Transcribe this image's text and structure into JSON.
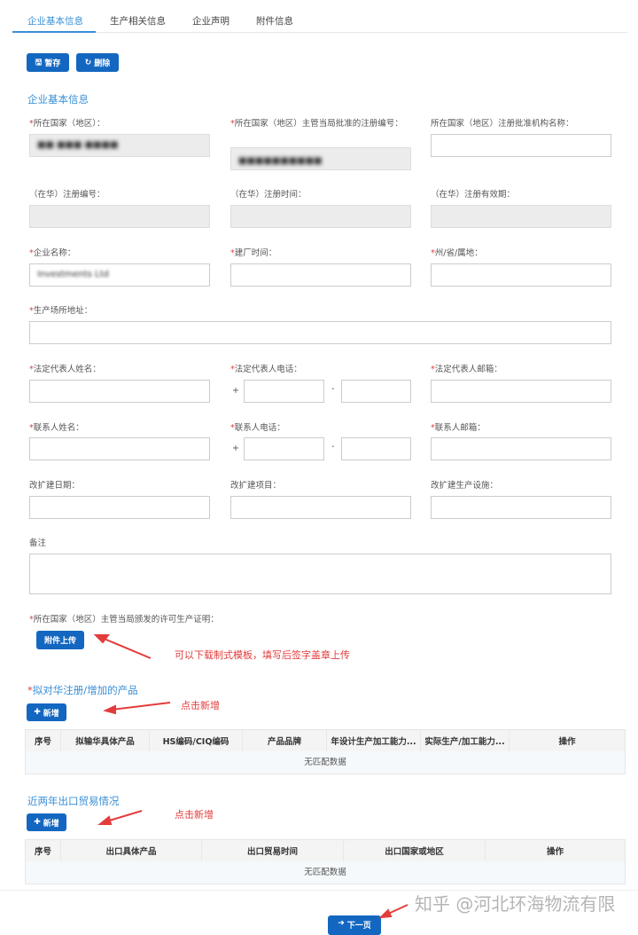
{
  "tabs": [
    "企业基本信息",
    "生产相关信息",
    "企业声明",
    "附件信息"
  ],
  "toolbar": {
    "save": "暂存",
    "delete": "删除"
  },
  "section1": {
    "title": "企业基本信息"
  },
  "fields": {
    "country": "所在国家（地区）：",
    "reg_no": "所在国家（地区）主管当局批准的注册编号：",
    "reg_org": "所在国家（地区）注册批准机构名称：",
    "cn_reg_no": "（在华）注册编号：",
    "cn_reg_time": "（在华）注册时间：",
    "cn_reg_valid": "（在华）注册有效期：",
    "company_name": "企业名称：",
    "company_name_value": "Investments Ltd",
    "build_time": "建厂时间：",
    "state": "州/省/属地：",
    "address": "生产场所地址：",
    "legal_name": "法定代表人姓名：",
    "legal_phone": "法定代表人电话：",
    "legal_email": "法定代表人邮箱：",
    "contact_name": "联系人姓名：",
    "contact_phone": "联系人电话：",
    "contact_email": "联系人邮箱：",
    "expand_date": "改扩建日期：",
    "expand_project": "改扩建项目：",
    "expand_facility": "改扩建生产设施：",
    "remark": "备注",
    "license": "所在国家（地区）主管当局颁发的许可生产证明：",
    "plus": "+",
    "dash": "-",
    "star": "*"
  },
  "upload_button": "附件上传",
  "annotations": {
    "upload": "可以下载制式模板，填写后签字盖章上传",
    "add1": "点击新增",
    "add2": "点击新增"
  },
  "products": {
    "title": "拟对华注册/增加的产品",
    "add": "新增",
    "columns": [
      "序号",
      "拟输华具体产品",
      "HS编码/CIQ编码",
      "产品品牌",
      "年设计生产加工能力...",
      "实际生产/加工能力...",
      "操作"
    ],
    "empty": "无匹配数据"
  },
  "exports": {
    "title": "近两年出口贸易情况",
    "add": "新增",
    "columns": [
      "序号",
      "出口具体产品",
      "出口贸易时间",
      "出口国家或地区",
      "操作"
    ],
    "empty": "无匹配数据"
  },
  "next_button": "下一页",
  "watermark": "知乎 @河北环海物流有限"
}
